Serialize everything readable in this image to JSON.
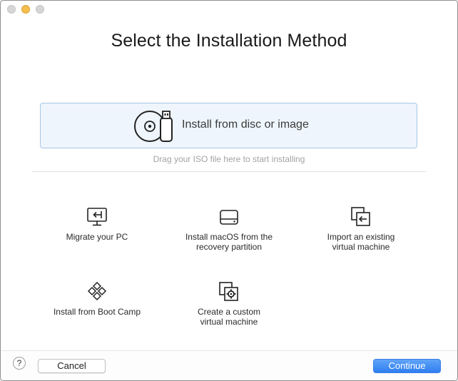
{
  "window": {
    "title": "Select the Installation Method",
    "traffic_lights": [
      "close",
      "minimize",
      "zoom"
    ]
  },
  "dropzone": {
    "label": "Install from disc or image",
    "hint": "Drag your ISO file here to start installing",
    "icon": "disc-and-usb-icon"
  },
  "options": [
    {
      "label": "Migrate your PC",
      "icon": "monitor-import-icon"
    },
    {
      "label": "Install macOS from the\nrecovery partition",
      "icon": "hard-drive-icon"
    },
    {
      "label": "Import an existing\nvirtual machine",
      "icon": "import-vm-icon"
    },
    {
      "label": "Install from Boot Camp",
      "icon": "boot-camp-icon"
    },
    {
      "label": "Create a custom\nvirtual machine",
      "icon": "custom-vm-icon"
    }
  ],
  "footer": {
    "help_label": "?",
    "cancel_label": "Cancel",
    "continue_label": "Continue"
  },
  "colors": {
    "accent": "#2f7ef0",
    "dropzone_bg": "#eef5fc",
    "dropzone_border": "#a9c7e6",
    "minimize_light": "#f5bf4f"
  }
}
